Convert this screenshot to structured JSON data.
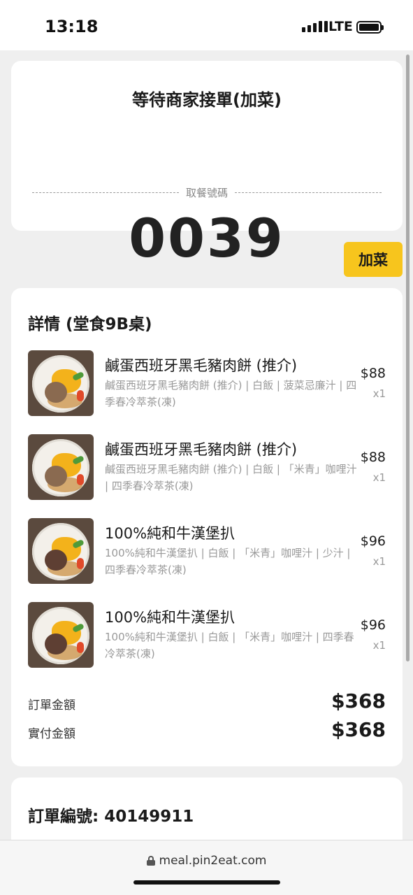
{
  "status_bar": {
    "time": "13:18",
    "network": "LTE",
    "signal_icon": "signal-bars-icon",
    "battery_icon": "battery-icon"
  },
  "order_status": {
    "title": "等待商家接單(加菜)",
    "pickup_label": "取餐號碼",
    "pickup_number": "0039"
  },
  "add_button_label": "加菜",
  "details": {
    "title": "詳情 (堂食9B桌)",
    "items": [
      {
        "name": "鹹蛋西班牙黑毛豬肉餅 (推介)",
        "desc": "鹹蛋西班牙黑毛豬肉餅 (推介) | 白飯 | 菠菜忌廉汁 | 四季春冷萃茶(凍)",
        "price": "$88",
        "qty": "x1"
      },
      {
        "name": "鹹蛋西班牙黑毛豬肉餅 (推介)",
        "desc": "鹹蛋西班牙黑毛豬肉餅 (推介) | 白飯 | 「米青」咖哩汁 | 四季春冷萃茶(凍)",
        "price": "$88",
        "qty": "x1"
      },
      {
        "name": "100%純和牛漢堡扒",
        "desc": "100%純和牛漢堡扒 | 白飯 | 「米青」咖哩汁 | 少汁 | 四季春冷萃茶(凍)",
        "price": "$96",
        "qty": "x1"
      },
      {
        "name": "100%純和牛漢堡扒",
        "desc": "100%純和牛漢堡扒 | 白飯 | 「米青」咖哩汁 | 四季春冷萃茶(凍)",
        "price": "$96",
        "qty": "x1"
      }
    ],
    "order_amount_label": "訂單金額",
    "order_amount": "$368",
    "paid_amount_label": "實付金額",
    "paid_amount": "$368"
  },
  "order_number_label": "訂單編號: 40149911",
  "browser": {
    "url": "meal.pin2eat.com",
    "lock_icon": "lock-icon"
  },
  "colors": {
    "accent": "#f7c51d",
    "background": "#efefef",
    "card": "#ffffff"
  }
}
